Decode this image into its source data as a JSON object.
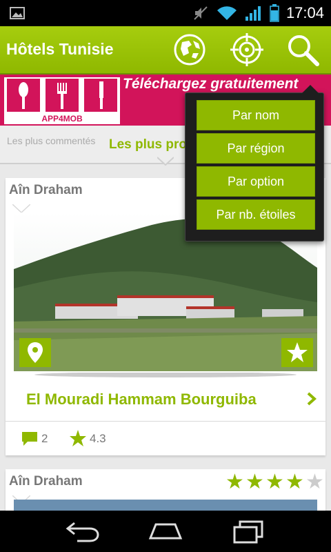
{
  "status_bar": {
    "time": "17:04",
    "icons": [
      "image-icon",
      "mute-icon",
      "wifi-icon",
      "signal-icon",
      "battery-icon"
    ]
  },
  "action_bar": {
    "title": "Hôtels Tunisie",
    "icons": [
      "globe-map-icon",
      "target-location-icon",
      "search-icon"
    ]
  },
  "banner": {
    "logo_text": "APP4MOB",
    "text": "Téléchargez gratuitement"
  },
  "tabs": {
    "items": [
      "Les plus commentés",
      "Les plus proches"
    ]
  },
  "search_menu": {
    "items": [
      "Par nom",
      "Par région",
      "Par option",
      "Par nb. étoiles"
    ]
  },
  "hotels": [
    {
      "region": "Aîn Draham",
      "name": "El Mouradi Hammam Bourguiba",
      "comments": "2",
      "rating": "4.3"
    },
    {
      "region": "Aîn Draham",
      "stars": 4,
      "max_stars": 5
    }
  ],
  "colors": {
    "accent": "#8fb800",
    "banner": "#d2145a",
    "star_empty": "#cccccc"
  }
}
